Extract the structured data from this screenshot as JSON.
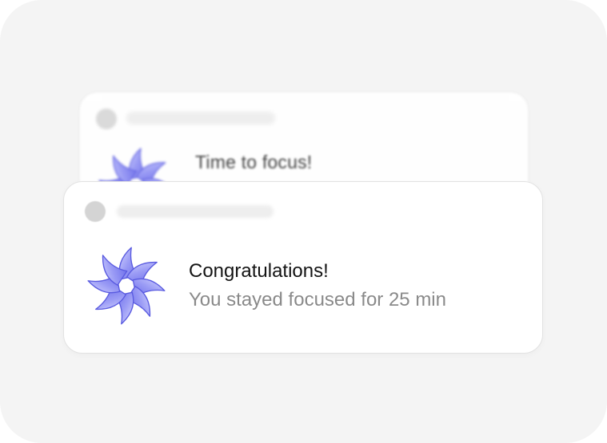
{
  "colors": {
    "page_background": "#f4f4f4",
    "card_background": "#ffffff",
    "logo_primary": "#7b7cf0",
    "logo_secondary": "#c7c8ff",
    "title_text": "#141414",
    "body_text": "#8a8a8a"
  },
  "notifications": [
    {
      "state": "background-blurred",
      "app_icon": "app-icon-placeholder",
      "logo_icon": "pinwheel-logo-icon",
      "title": "Time to focus!"
    },
    {
      "state": "foreground",
      "app_icon": "app-icon-placeholder",
      "logo_icon": "pinwheel-logo-icon",
      "title": "Congratulations!",
      "body": "You stayed focused for 25 min"
    }
  ]
}
